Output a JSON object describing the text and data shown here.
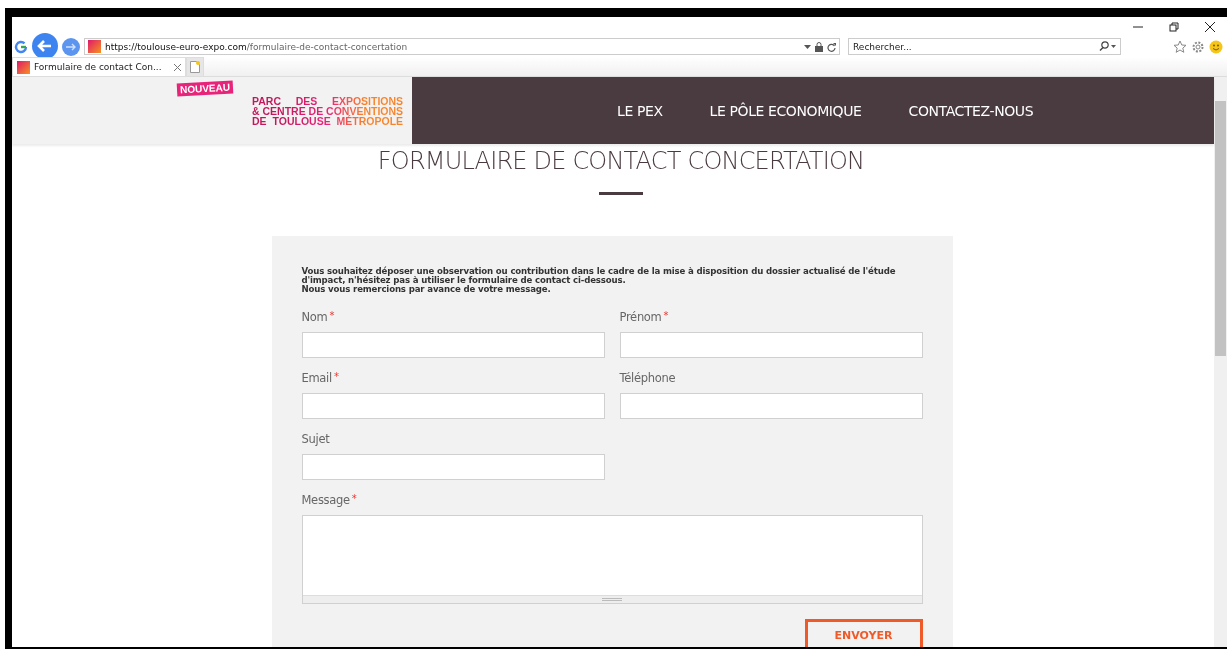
{
  "browser": {
    "address": {
      "host": "https://toulouse-euro-expo.com",
      "path": "/formulaire-de-contact-concertation"
    },
    "search": {
      "placeholder": "Rechercher..."
    },
    "tabs": [
      {
        "label": "Formulaire de contact Con...",
        "selected": true
      }
    ]
  },
  "header": {
    "badge": "NOUVEAU",
    "logo_lines": [
      "PARC DES EXPOSITIONS",
      "& CENTRE DE CONVENTIONS",
      "DE TOULOUSE MÉTROPOLE"
    ],
    "nav": [
      "LE PEX",
      "LE PÔLE ECONOMIQUE",
      "CONTACTEZ-NOUS"
    ]
  },
  "page": {
    "title": "FORMULAIRE DE CONTACT CONCERTATION"
  },
  "form": {
    "intro": [
      "Vous souhaitez déposer une observation ou contribution dans le cadre de la mise à disposition du dossier actualisé de l'étude d'impact, n'hésitez pas à utiliser le formulaire de contact ci-dessous.",
      "Nous vous remercions par avance de votre message."
    ],
    "fields": [
      {
        "label": "Nom",
        "required": true,
        "required_mark": "*",
        "kind": "text"
      },
      {
        "label": "Prénom",
        "required": true,
        "required_mark": "*",
        "kind": "text"
      },
      {
        "label": "Email",
        "required": true,
        "required_mark": "*",
        "kind": "text"
      },
      {
        "label": "Téléphone",
        "required": false,
        "kind": "text"
      },
      {
        "label": "Sujet",
        "required": false,
        "kind": "text"
      },
      {
        "label": "Message",
        "required": true,
        "required_mark": "*",
        "kind": "textarea"
      }
    ],
    "submit": "ENVOYER"
  }
}
